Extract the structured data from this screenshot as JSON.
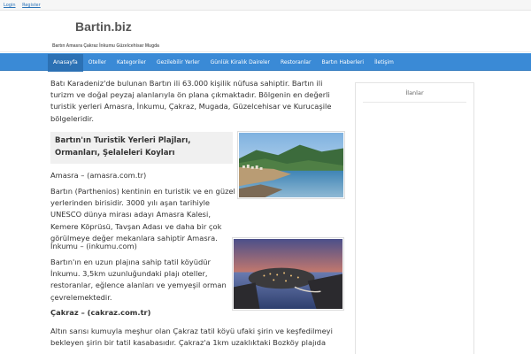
{
  "topbar": {
    "login": "Login",
    "register": "Register"
  },
  "header": {
    "logo": "Bartin.biz",
    "tagline": "Bartın Amasra Çakraz İnkumu Güzelcehisar Mugda"
  },
  "nav": {
    "items": [
      "Anasayfa",
      "Oteller",
      "Kategoriler",
      "Gezilebilir Yerler",
      "Günlük Kiralık Daireler",
      "Restoranlar",
      "Bartın Haberleri",
      "İletişim"
    ]
  },
  "main": {
    "intro": "Batı Karadeniz'de bulunan Bartın ili 63.000 kişilik nüfusa sahiptir. Bartın ili turizm ve doğal peyzaj alanlarıyla ön plana çıkmaktadır. Bölgenin en değerli turistik yerleri Amasra, İnkumu, Çakraz, Mugada, Güzelcehisar ve Kurucaşile bölgeleridir.",
    "section_title": "Bartın'ın Turistik Yerleri Plajları, Ormanları, Şelaleleri Koyları",
    "amasra_heading": "Amasra – (amasra.com.tr)",
    "amasra_text": "Bartın (Parthenios) kentinin en turistik ve en güzel yerlerinden birisidir. 3000 yılı aşan tarihiyle UNESCO dünya mirası adayı Amasra Kalesi, Kemere Köprüsü, Tavşan Adası ve daha bir çok görülmeye değer mekanlara sahiptir Amasra.",
    "inkumu_heading": "İnkumu – (inkumu.com)",
    "inkumu_text": "Bartın'ın en uzun plajına sahip tatil köyüdür İnkumu. 3,5km uzunluğundaki plajı oteller, restoranlar, eğlence alanları ve yemyeşil orman çevrelemektedir.",
    "cakraz_heading": "Çakraz – (cakraz.com.tr)",
    "cakraz_text": "Altın sarısı kumuyla meşhur olan Çakraz tatil köyü ufaki şirin ve keşfedilmeyi bekleyen şirin bir tatil kasabasıdır. Çakraz'a 1km uzaklıktaki Bozköy plajıda"
  },
  "sidebar": {
    "title": "İlanlar"
  },
  "colors": {
    "nav": "#3a8ad6",
    "nav_active": "#2c71b4",
    "link": "#2a73b8"
  }
}
